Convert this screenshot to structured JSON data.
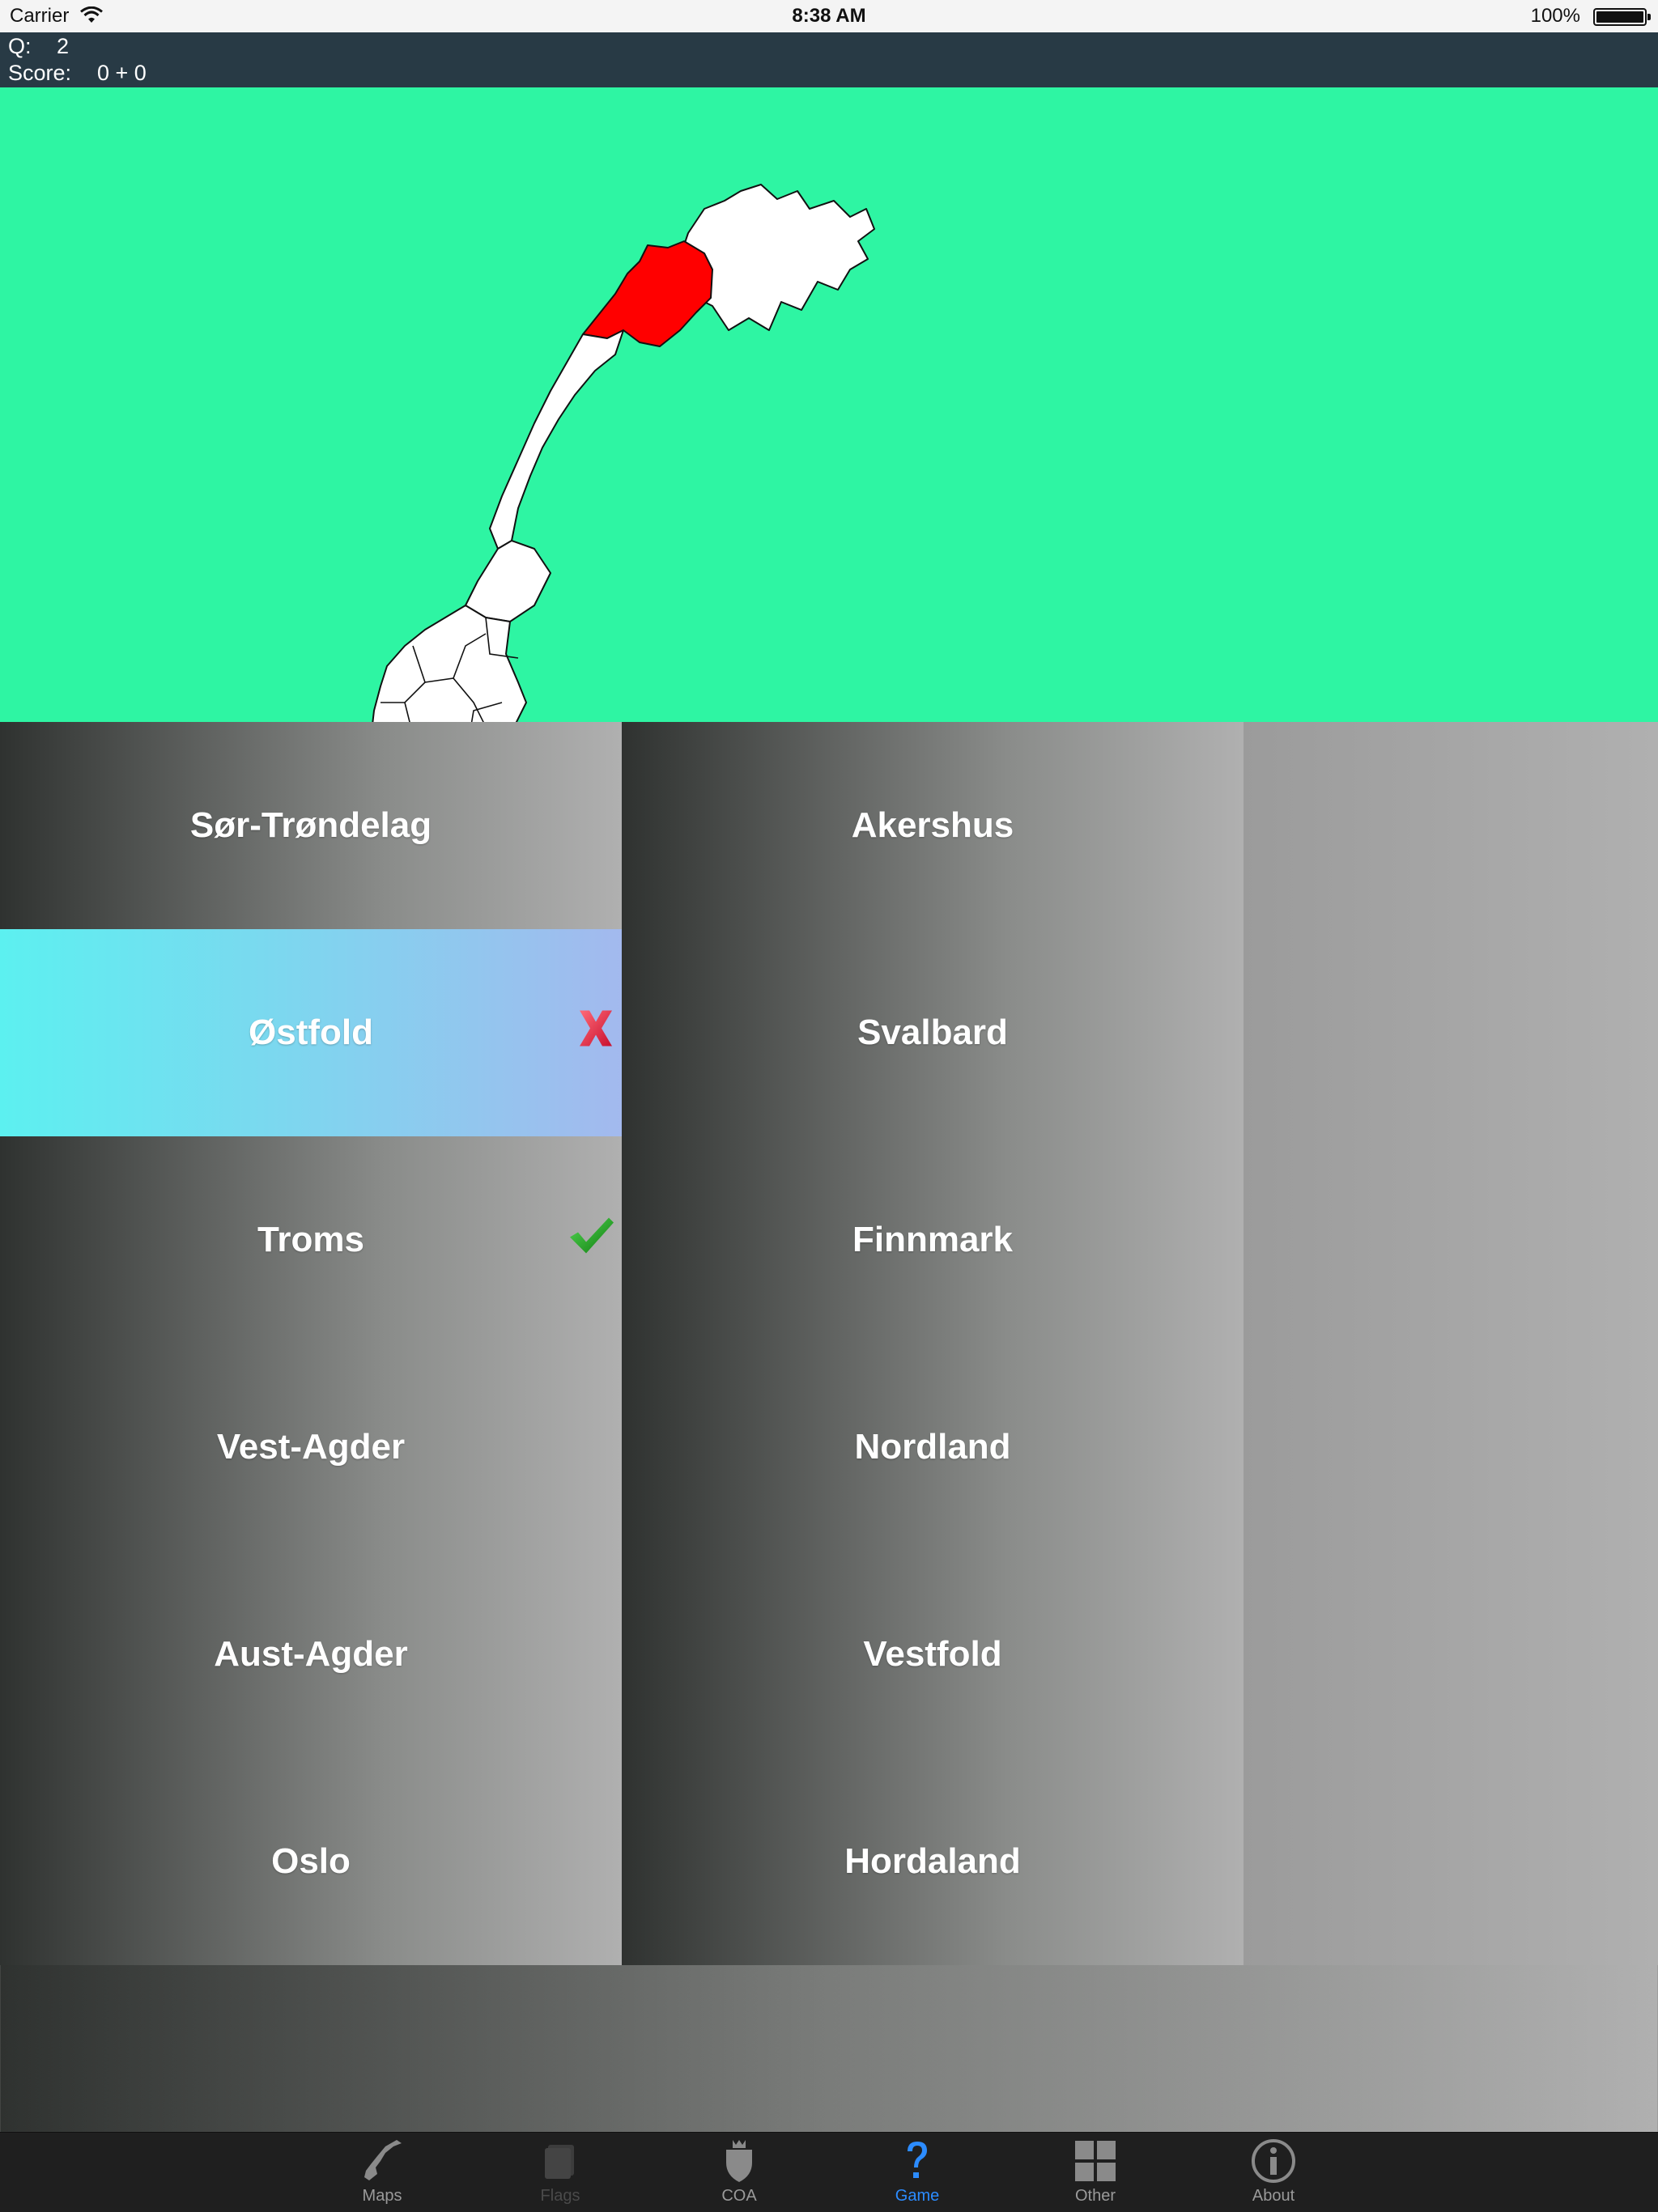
{
  "status_bar": {
    "carrier": "Carrier",
    "time": "8:38 AM",
    "battery": "100%"
  },
  "score": {
    "q_label": "Q:",
    "q_value": "2",
    "score_label": "Score:",
    "score_value": "0 + 0"
  },
  "map": {
    "background_color": "#2ef5a3",
    "highlight_color": "#ff0000",
    "region_fill": "#ffffff"
  },
  "answers": [
    {
      "label": "Sør-Trøndelag",
      "state": "normal"
    },
    {
      "label": "Akershus",
      "state": "normal"
    },
    {
      "label": "Østfold",
      "state": "wrong"
    },
    {
      "label": "Svalbard",
      "state": "normal"
    },
    {
      "label": "Troms",
      "state": "correct"
    },
    {
      "label": "Finnmark",
      "state": "normal"
    },
    {
      "label": "Vest-Agder",
      "state": "normal"
    },
    {
      "label": "Nordland",
      "state": "normal"
    },
    {
      "label": "Aust-Agder",
      "state": "normal"
    },
    {
      "label": "Vestfold",
      "state": "normal"
    },
    {
      "label": "Oslo",
      "state": "normal"
    },
    {
      "label": "Hordaland",
      "state": "normal"
    }
  ],
  "tabs": [
    {
      "label": "Maps",
      "icon": "norway-map-icon",
      "state": "normal"
    },
    {
      "label": "Flags",
      "icon": "flag-book-icon",
      "state": "disabled"
    },
    {
      "label": "COA",
      "icon": "shield-crown-icon",
      "state": "normal"
    },
    {
      "label": "Game",
      "icon": "question-mark-icon",
      "state": "active"
    },
    {
      "label": "Other",
      "icon": "grid-icon",
      "state": "normal"
    },
    {
      "label": "About",
      "icon": "info-icon",
      "state": "normal"
    }
  ],
  "colors": {
    "active_tab": "#2c8cff",
    "header_bg": "#283a45",
    "wrong_mark": "#e8233a",
    "correct_mark": "#1aa01a"
  }
}
